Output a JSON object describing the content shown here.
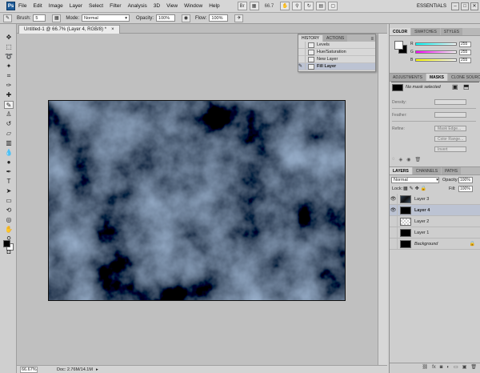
{
  "menubar": {
    "logo": "Ps",
    "items": [
      "File",
      "Edit",
      "Image",
      "Layer",
      "Select",
      "Filter",
      "Analysis",
      "3D",
      "View",
      "Window",
      "Help"
    ],
    "zoom": "66.7",
    "workspace": "ESSENTIALS"
  },
  "options": {
    "brush_label": "Brush:",
    "brush_size": "5",
    "mode_label": "Mode:",
    "mode_value": "Normal",
    "opacity_label": "Opacity:",
    "opacity_value": "100%",
    "flow_label": "Flow:",
    "flow_value": "100%"
  },
  "document": {
    "tab_title": "Untitled-1 @ 66.7% (Layer 4, RGB/8) *",
    "status_zoom": "66.67%",
    "status_doc": "Doc: 2.76M/14.1M",
    "canvas_fill": "#0c0f13"
  },
  "history": {
    "tabs": [
      "HISTORY",
      "ACTIONS"
    ],
    "items": [
      "Levels",
      "Hue/Saturation",
      "New Layer",
      "Fill Layer"
    ],
    "selected": 3
  },
  "color_panel": {
    "tabs": [
      "COLOR",
      "SWATCHES",
      "STYLES"
    ],
    "r_label": "R",
    "g_label": "G",
    "b_label": "B",
    "r_value": "255",
    "g_value": "255",
    "b_value": "255"
  },
  "masks_panel": {
    "tabs": [
      "ADJUSTMENTS",
      "MASKS",
      "CLONE SOURCE"
    ],
    "status": "No mask selected",
    "density_label": "Density:",
    "feather_label": "Feather:",
    "refine_label": "Refine:",
    "mask_edge": "Mask Edge...",
    "color_range": "Color Range...",
    "invert": "Invert"
  },
  "layers_panel": {
    "tabs": [
      "LAYERS",
      "CHANNELS",
      "PATHS"
    ],
    "blend_mode": "Normal",
    "opacity_label": "Opacity:",
    "opacity_value": "100%",
    "lock_label": "Lock:",
    "fill_label": "Fill:",
    "fill_value": "100%",
    "layers": [
      "Layer 3",
      "Layer 4",
      "Layer 2",
      "Layer 1",
      "Background"
    ],
    "selected": 1
  },
  "colors": {
    "accent_selected": "#bcc3d3",
    "ps_blue": "#1e5c9a"
  }
}
